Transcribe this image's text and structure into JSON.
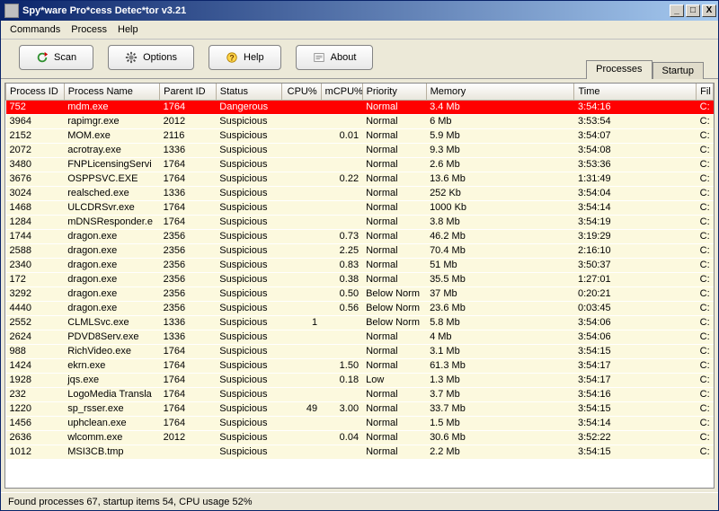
{
  "window": {
    "title": "Spy*ware Pro*cess Detec*tor v3.21",
    "min_hint": "_",
    "max_hint": "□",
    "close_hint": "X"
  },
  "menu": [
    "Commands",
    "Process",
    "Help"
  ],
  "toolbar": {
    "scan": "Scan",
    "options": "Options",
    "help": "Help",
    "about": "About"
  },
  "tabs": {
    "processes": "Processes",
    "startup": "Startup"
  },
  "columns": {
    "pid": "Process ID",
    "name": "Process Name",
    "parent": "Parent ID",
    "status": "Status",
    "cpu": "CPU%",
    "mcpu": "mCPU%",
    "priority": "Priority",
    "memory": "Memory",
    "time": "Time",
    "file": "Fil"
  },
  "rows": [
    {
      "pid": "752",
      "name": "mdm.exe",
      "parent": "1764",
      "status": "Dangerous",
      "cpu": "",
      "mcpu": "",
      "priority": "Normal",
      "memory": "3.4 Mb",
      "time": "3:54:16",
      "file": "C:",
      "danger": true
    },
    {
      "pid": "3964",
      "name": "rapimgr.exe",
      "parent": "2012",
      "status": "Suspicious",
      "cpu": "",
      "mcpu": "",
      "priority": "Normal",
      "memory": "6 Mb",
      "time": "3:53:54",
      "file": "C:"
    },
    {
      "pid": "2152",
      "name": "MOM.exe",
      "parent": "2116",
      "status": "Suspicious",
      "cpu": "",
      "mcpu": "0.01",
      "priority": "Normal",
      "memory": "5.9 Mb",
      "time": "3:54:07",
      "file": "C:"
    },
    {
      "pid": "2072",
      "name": "acrotray.exe",
      "parent": "1336",
      "status": "Suspicious",
      "cpu": "",
      "mcpu": "",
      "priority": "Normal",
      "memory": "9.3 Mb",
      "time": "3:54:08",
      "file": "C:"
    },
    {
      "pid": "3480",
      "name": "FNPLicensingServi",
      "parent": "1764",
      "status": "Suspicious",
      "cpu": "",
      "mcpu": "",
      "priority": "Normal",
      "memory": "2.6 Mb",
      "time": "3:53:36",
      "file": "C:"
    },
    {
      "pid": "3676",
      "name": "OSPPSVC.EXE",
      "parent": "1764",
      "status": "Suspicious",
      "cpu": "",
      "mcpu": "0.22",
      "priority": "Normal",
      "memory": "13.6 Mb",
      "time": "1:31:49",
      "file": "C:"
    },
    {
      "pid": "3024",
      "name": "realsched.exe",
      "parent": "1336",
      "status": "Suspicious",
      "cpu": "",
      "mcpu": "",
      "priority": "Normal",
      "memory": "252 Kb",
      "time": "3:54:04",
      "file": "C:"
    },
    {
      "pid": "1468",
      "name": "ULCDRSvr.exe",
      "parent": "1764",
      "status": "Suspicious",
      "cpu": "",
      "mcpu": "",
      "priority": "Normal",
      "memory": "1000 Kb",
      "time": "3:54:14",
      "file": "C:"
    },
    {
      "pid": "1284",
      "name": "mDNSResponder.e",
      "parent": "1764",
      "status": "Suspicious",
      "cpu": "",
      "mcpu": "",
      "priority": "Normal",
      "memory": "3.8 Mb",
      "time": "3:54:19",
      "file": "C:"
    },
    {
      "pid": "1744",
      "name": "dragon.exe",
      "parent": "2356",
      "status": "Suspicious",
      "cpu": "",
      "mcpu": "0.73",
      "priority": "Normal",
      "memory": "46.2 Mb",
      "time": "3:19:29",
      "file": "C:"
    },
    {
      "pid": "2588",
      "name": "dragon.exe",
      "parent": "2356",
      "status": "Suspicious",
      "cpu": "",
      "mcpu": "2.25",
      "priority": "Normal",
      "memory": "70.4 Mb",
      "time": "2:16:10",
      "file": "C:"
    },
    {
      "pid": "2340",
      "name": "dragon.exe",
      "parent": "2356",
      "status": "Suspicious",
      "cpu": "",
      "mcpu": "0.83",
      "priority": "Normal",
      "memory": "51 Mb",
      "time": "3:50:37",
      "file": "C:"
    },
    {
      "pid": "172",
      "name": "dragon.exe",
      "parent": "2356",
      "status": "Suspicious",
      "cpu": "",
      "mcpu": "0.38",
      "priority": "Normal",
      "memory": "35.5 Mb",
      "time": "1:27:01",
      "file": "C:"
    },
    {
      "pid": "3292",
      "name": "dragon.exe",
      "parent": "2356",
      "status": "Suspicious",
      "cpu": "",
      "mcpu": "0.50",
      "priority": "Below Norm",
      "memory": "37 Mb",
      "time": "0:20:21",
      "file": "C:"
    },
    {
      "pid": "4440",
      "name": "dragon.exe",
      "parent": "2356",
      "status": "Suspicious",
      "cpu": "",
      "mcpu": "0.56",
      "priority": "Below Norm",
      "memory": "23.6 Mb",
      "time": "0:03:45",
      "file": "C:"
    },
    {
      "pid": "2552",
      "name": "CLMLSvc.exe",
      "parent": "1336",
      "status": "Suspicious",
      "cpu": "1",
      "mcpu": "",
      "priority": "Below Norm",
      "memory": "5.8 Mb",
      "time": "3:54:06",
      "file": "C:"
    },
    {
      "pid": "2624",
      "name": "PDVD8Serv.exe",
      "parent": "1336",
      "status": "Suspicious",
      "cpu": "",
      "mcpu": "",
      "priority": "Normal",
      "memory": "4 Mb",
      "time": "3:54:06",
      "file": "C:"
    },
    {
      "pid": "988",
      "name": "RichVideo.exe",
      "parent": "1764",
      "status": "Suspicious",
      "cpu": "",
      "mcpu": "",
      "priority": "Normal",
      "memory": "3.1 Mb",
      "time": "3:54:15",
      "file": "C:"
    },
    {
      "pid": "1424",
      "name": "ekrn.exe",
      "parent": "1764",
      "status": "Suspicious",
      "cpu": "",
      "mcpu": "1.50",
      "priority": "Normal",
      "memory": "61.3 Mb",
      "time": "3:54:17",
      "file": "C:"
    },
    {
      "pid": "1928",
      "name": "jqs.exe",
      "parent": "1764",
      "status": "Suspicious",
      "cpu": "",
      "mcpu": "0.18",
      "priority": "Low",
      "memory": "1.3 Mb",
      "time": "3:54:17",
      "file": "C:"
    },
    {
      "pid": "232",
      "name": "LogoMedia Transla",
      "parent": "1764",
      "status": "Suspicious",
      "cpu": "",
      "mcpu": "",
      "priority": "Normal",
      "memory": "3.7 Mb",
      "time": "3:54:16",
      "file": "C:"
    },
    {
      "pid": "1220",
      "name": "sp_rsser.exe",
      "parent": "1764",
      "status": "Suspicious",
      "cpu": "49",
      "mcpu": "3.00",
      "priority": "Normal",
      "memory": "33.7 Mb",
      "time": "3:54:15",
      "file": "C:"
    },
    {
      "pid": "1456",
      "name": "uphclean.exe",
      "parent": "1764",
      "status": "Suspicious",
      "cpu": "",
      "mcpu": "",
      "priority": "Normal",
      "memory": "1.5 Mb",
      "time": "3:54:14",
      "file": "C:"
    },
    {
      "pid": "2636",
      "name": "wlcomm.exe",
      "parent": "2012",
      "status": "Suspicious",
      "cpu": "",
      "mcpu": "0.04",
      "priority": "Normal",
      "memory": "30.6 Mb",
      "time": "3:52:22",
      "file": "C:"
    },
    {
      "pid": "1012",
      "name": "MSI3CB.tmp",
      "parent": "",
      "status": "Suspicious",
      "cpu": "",
      "mcpu": "",
      "priority": "Normal",
      "memory": "2.2 Mb",
      "time": "3:54:15",
      "file": "C:"
    }
  ],
  "statusbar": "Found processes 67,  startup items 54, CPU usage 52%"
}
